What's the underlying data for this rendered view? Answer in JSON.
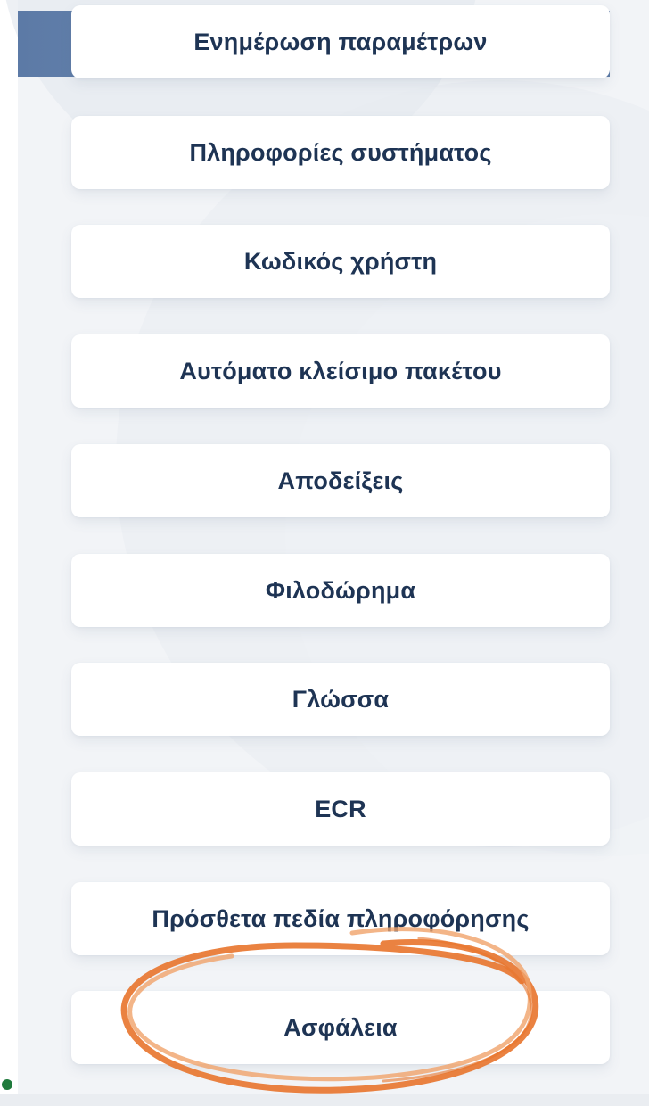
{
  "menu": {
    "items": [
      {
        "label": "Ενημέρωση παραμέτρων"
      },
      {
        "label": "Πληροφορίες συστήματος"
      },
      {
        "label": "Κωδικός χρήστη"
      },
      {
        "label": "Αυτόματο κλείσιμο πακέτου"
      },
      {
        "label": "Αποδείξεις"
      },
      {
        "label": "Φιλοδώρημα"
      },
      {
        "label": "Γλώσσα"
      },
      {
        "label": "ECR"
      },
      {
        "label": "Πρόσθετα πεδία πληροφόρησης"
      },
      {
        "label": "Ασφάλεια"
      }
    ]
  },
  "theme": {
    "header_color": "#5c7aa6",
    "card_color": "#ffffff",
    "text_color": "#1e3454",
    "annotation_color": "#e8742c",
    "dot_color": "#1f7a3c"
  },
  "annotation": {
    "shape": "hand-drawn-circle",
    "target": "Ασφάλεια"
  }
}
